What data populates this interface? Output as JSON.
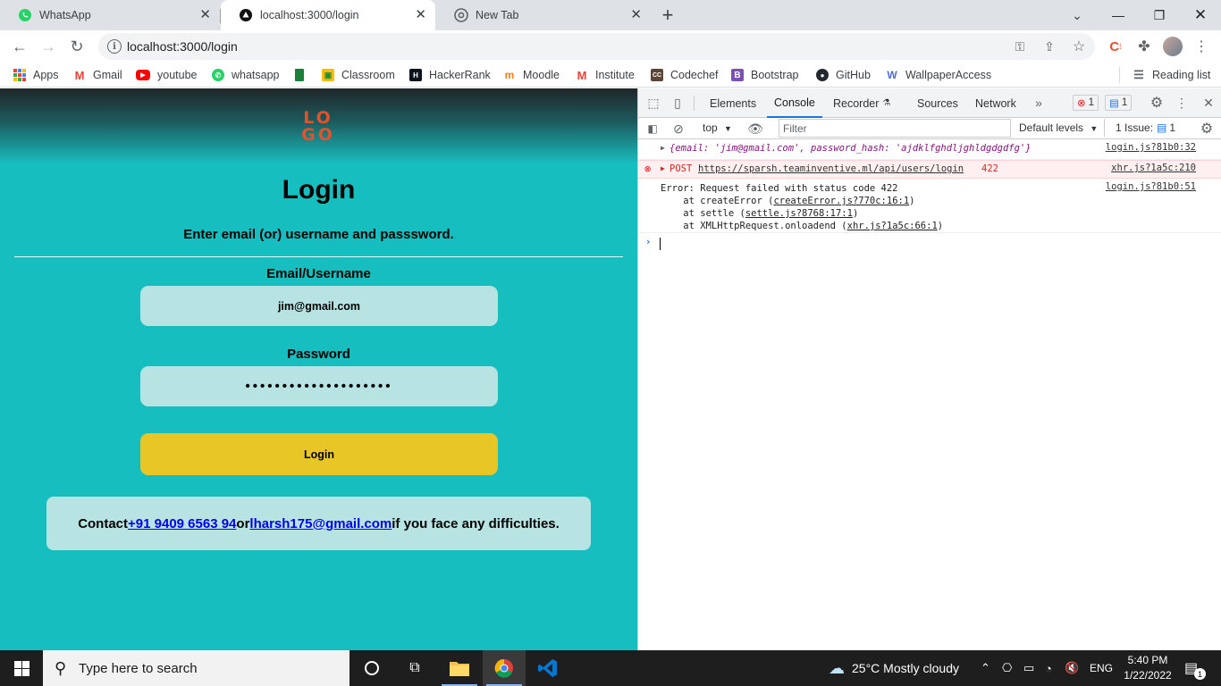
{
  "browser": {
    "tabs": [
      {
        "title": "WhatsApp",
        "icon": "whatsapp-icon",
        "active": false
      },
      {
        "title": "localhost:3000/login",
        "icon": "app-icon",
        "active": true
      },
      {
        "title": "New Tab",
        "icon": "chrome-icon",
        "active": false
      }
    ],
    "url": "localhost:3000/login",
    "bookmarks": [
      {
        "label": "Apps",
        "icon": "apps-grid-icon"
      },
      {
        "label": "Gmail",
        "icon": "gmail-icon"
      },
      {
        "label": "youtube",
        "icon": "youtube-icon"
      },
      {
        "label": "whatsapp",
        "icon": "whatsapp-icon"
      },
      {
        "label": "",
        "icon": "bookmark-icon"
      },
      {
        "label": "Classroom",
        "icon": "classroom-icon"
      },
      {
        "label": "HackerRank",
        "icon": "hackerrank-icon"
      },
      {
        "label": "Moodle",
        "icon": "moodle-icon"
      },
      {
        "label": "Institute",
        "icon": "gmail-icon"
      },
      {
        "label": "Codechef",
        "icon": "codechef-icon"
      },
      {
        "label": "Bootstrap",
        "icon": "bootstrap-icon"
      },
      {
        "label": "GitHub",
        "icon": "github-icon"
      },
      {
        "label": "WallpaperAccess",
        "icon": "wallpaper-icon"
      }
    ],
    "reading_list": "Reading list"
  },
  "page": {
    "logo_text": "LOGO",
    "title": "Login",
    "subtitle": "Enter email (or) username and passsword.",
    "email_label": "Email/Username",
    "email_value": "jim@gmail.com",
    "password_label": "Password",
    "password_value": "••••••••••••••••••••",
    "login_button": "Login",
    "contact": {
      "prefix": "Contact ",
      "phone": "+91 9409 6563 94",
      "middle": " or ",
      "email": "lharsh175@gmail.com",
      "suffix": " if you face any difficulties."
    },
    "colors": {
      "background": "#17bebf",
      "input": "#b8e3e3",
      "button": "#e8c625",
      "logo": "#e5522a"
    }
  },
  "devtools": {
    "tabs": [
      "Elements",
      "Console",
      "Recorder",
      "Sources",
      "Network"
    ],
    "active_tab": "Console",
    "error_count": "1",
    "message_count": "1",
    "context": "top",
    "filter_placeholder": "Filter",
    "levels": "Default levels",
    "issues_label": "1 Issue:",
    "issues_count": "1",
    "logs": [
      {
        "text": "{email: 'jim@gmail.com', password_hash: 'ajdklfghdljghldgdgdfg'}",
        "source": "login.js?81b0:32"
      },
      {
        "method": "POST",
        "url": "https://sparsh.teaminventive.ml/api/users/login",
        "status": "422",
        "source": "xhr.js?1a5c:210"
      },
      {
        "message": "Error: Request failed with status code 422",
        "stack": [
          {
            "prefix": "    at createError (",
            "link": "createError.js?770c:16:1",
            "suffix": ")"
          },
          {
            "prefix": "    at settle (",
            "link": "settle.js?8768:17:1",
            "suffix": ")"
          },
          {
            "prefix": "    at XMLHttpRequest.onloadend (",
            "link": "xhr.js?1a5c:66:1",
            "suffix": ")"
          }
        ],
        "source": "login.js?81b0:51"
      }
    ]
  },
  "taskbar": {
    "search_placeholder": "Type here to search",
    "weather": "25°C  Mostly cloudy",
    "language": "ENG",
    "time": "5:40 PM",
    "date": "1/22/2022",
    "notifications": "1"
  }
}
